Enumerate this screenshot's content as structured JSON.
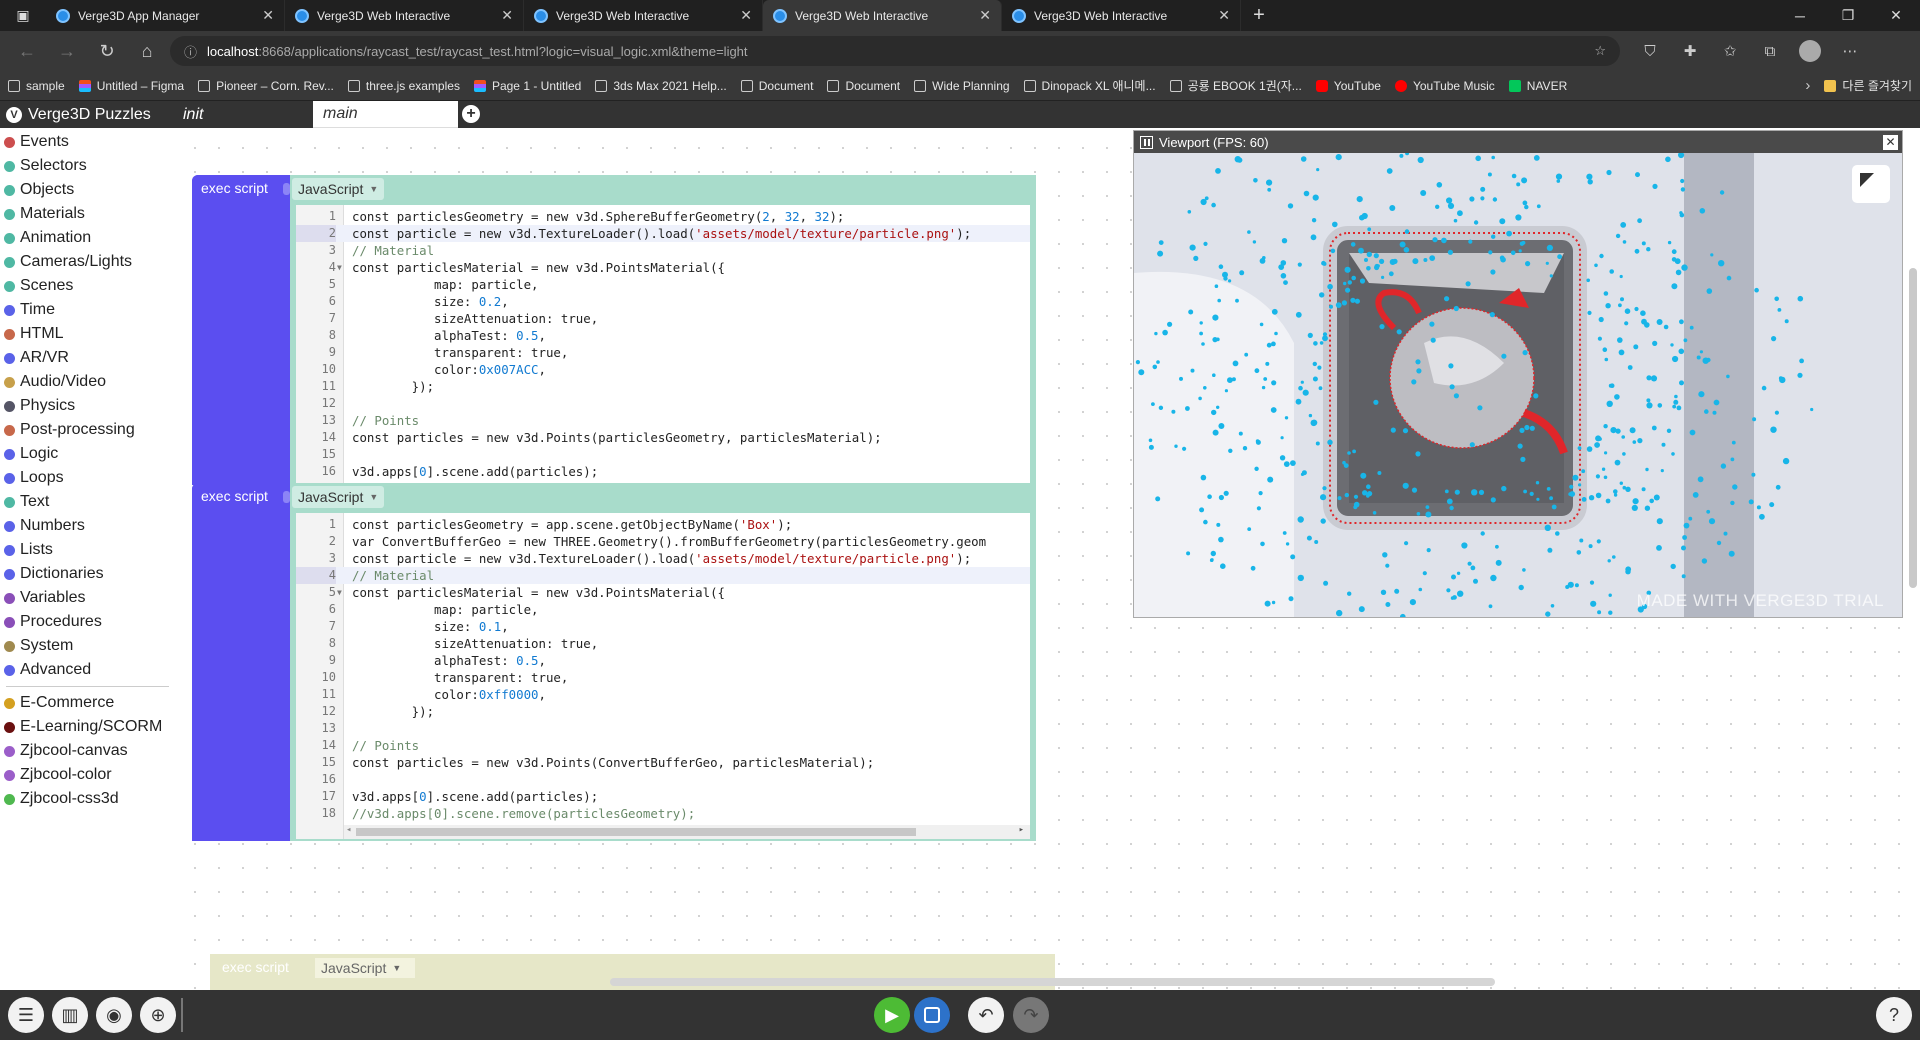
{
  "browser": {
    "tabs": [
      {
        "label": "Verge3D App Manager",
        "active": false
      },
      {
        "label": "Verge3D Web Interactive",
        "active": false
      },
      {
        "label": "Verge3D Web Interactive",
        "active": false
      },
      {
        "label": "Verge3D Web Interactive",
        "active": true
      },
      {
        "label": "Verge3D Web Interactive",
        "active": false
      }
    ],
    "url_host": "localhost",
    "url_rest": ":8668/applications/raycast_test/raycast_test.html?logic=visual_logic.xml&theme=light",
    "bookmarks": [
      {
        "label": "sample",
        "icon": "folder-icon"
      },
      {
        "label": "Untitled – Figma",
        "icon": "figma-icon"
      },
      {
        "label": "Pioneer – Corn. Rev...",
        "icon": "leaf-icon"
      },
      {
        "label": "three.js examples",
        "icon": "threejs-icon"
      },
      {
        "label": "Page 1 - Untitled",
        "icon": "figma-icon"
      },
      {
        "label": "3ds Max 2021 Help...",
        "icon": "autodesk-icon"
      },
      {
        "label": "Document",
        "icon": "page-icon"
      },
      {
        "label": "Document",
        "icon": "page-icon"
      },
      {
        "label": "Wide Planning",
        "icon": "page-icon"
      },
      {
        "label": "Dinopack XL 애니메...",
        "icon": "dino-icon"
      },
      {
        "label": "공룡 EBOOK 1권(자...",
        "icon": "doc-icon"
      },
      {
        "label": "YouTube",
        "icon": "youtube-icon"
      },
      {
        "label": "YouTube Music",
        "icon": "youtube-music-icon"
      },
      {
        "label": "NAVER",
        "icon": "naver-icon"
      }
    ],
    "other_bookmarks": "다른 즐겨찾기"
  },
  "app": {
    "brand": "Verge3D Puzzles",
    "workspace_tabs": [
      "init",
      "main"
    ]
  },
  "categories": [
    {
      "label": "Events",
      "color": "#cc4e4e"
    },
    {
      "label": "Selectors",
      "color": "#4fb8a3"
    },
    {
      "label": "Objects",
      "color": "#4fb8a3"
    },
    {
      "label": "Materials",
      "color": "#4fb8a3"
    },
    {
      "label": "Animation",
      "color": "#4fb8a3"
    },
    {
      "label": "Cameras/Lights",
      "color": "#4fb8a3"
    },
    {
      "label": "Scenes",
      "color": "#4fb8a3"
    },
    {
      "label": "Time",
      "color": "#5a62e8"
    },
    {
      "label": "HTML",
      "color": "#c7684a"
    },
    {
      "label": "AR/VR",
      "color": "#5a62e8"
    },
    {
      "label": "Audio/Video",
      "color": "#c7a04a"
    },
    {
      "label": "Physics",
      "color": "#555566"
    },
    {
      "label": "Post-processing",
      "color": "#c7684a"
    },
    {
      "label": "Logic",
      "color": "#5a62e8"
    },
    {
      "label": "Loops",
      "color": "#5a62e8"
    },
    {
      "label": "Text",
      "color": "#4fb8a3"
    },
    {
      "label": "Numbers",
      "color": "#5a62e8"
    },
    {
      "label": "Lists",
      "color": "#5a62e8"
    },
    {
      "label": "Dictionaries",
      "color": "#5a62e8"
    },
    {
      "label": "Variables",
      "color": "#8a4fb8"
    },
    {
      "label": "Procedures",
      "color": "#8a4fb8"
    },
    {
      "label": "System",
      "color": "#a08a4f"
    },
    {
      "label": "Advanced",
      "color": "#5a62e8"
    }
  ],
  "plugins": [
    {
      "label": "E-Commerce",
      "color": "#d4a020"
    },
    {
      "label": "E-Learning/SCORM",
      "color": "#6a1010"
    },
    {
      "label": "Zjbcool-canvas",
      "color": "#9b5ec9"
    },
    {
      "label": "Zjbcool-color",
      "color": "#9b5ec9"
    },
    {
      "label": "Zjbcool-css3d",
      "color": "#4fb84f"
    }
  ],
  "blocks": [
    {
      "label": "exec script",
      "lang": "JavaScript",
      "lines": [
        "const particlesGeometry = new v3d.SphereBufferGeometry(2, 32, 32);",
        "const particle = new v3d.TextureLoader().load('assets/model/texture/particle.png');",
        "// Material",
        "const particlesMaterial = new v3d.PointsMaterial({",
        "           map: particle,",
        "           size: 0.2,",
        "           sizeAttenuation: true,",
        "           alphaTest: 0.5,",
        "           transparent: true,",
        "           color:0x007ACC,",
        "        });",
        "",
        "// Points",
        "const particles = new v3d.Points(particlesGeometry, particlesMaterial);",
        "",
        "v3d.apps[0].scene.add(particles);"
      ]
    },
    {
      "label": "exec script",
      "lang": "JavaScript",
      "lines": [
        "const particlesGeometry = app.scene.getObjectByName('Box');",
        "var ConvertBufferGeo = new THREE.Geometry().fromBufferGeometry(particlesGeometry.geom",
        "const particle = new v3d.TextureLoader().load('assets/model/texture/particle.png');",
        "// Material",
        "const particlesMaterial = new v3d.PointsMaterial({",
        "           map: particle,",
        "           size: 0.1,",
        "           sizeAttenuation: true,",
        "           alphaTest: 0.5,",
        "           transparent: true,",
        "           color:0xff0000,",
        "        });",
        "",
        "// Points",
        "const particles = new v3d.Points(ConvertBufferGeo, particlesMaterial);",
        "",
        "v3d.apps[0].scene.add(particles);",
        "//v3d.apps[0].scene.remove(particlesGeometry);"
      ]
    }
  ],
  "ghost_block": {
    "label": "exec script",
    "lang": "JavaScript"
  },
  "viewport": {
    "title": "Viewport (FPS: 60)",
    "watermark": "MADE WITH VERGE3D TRIAL"
  }
}
